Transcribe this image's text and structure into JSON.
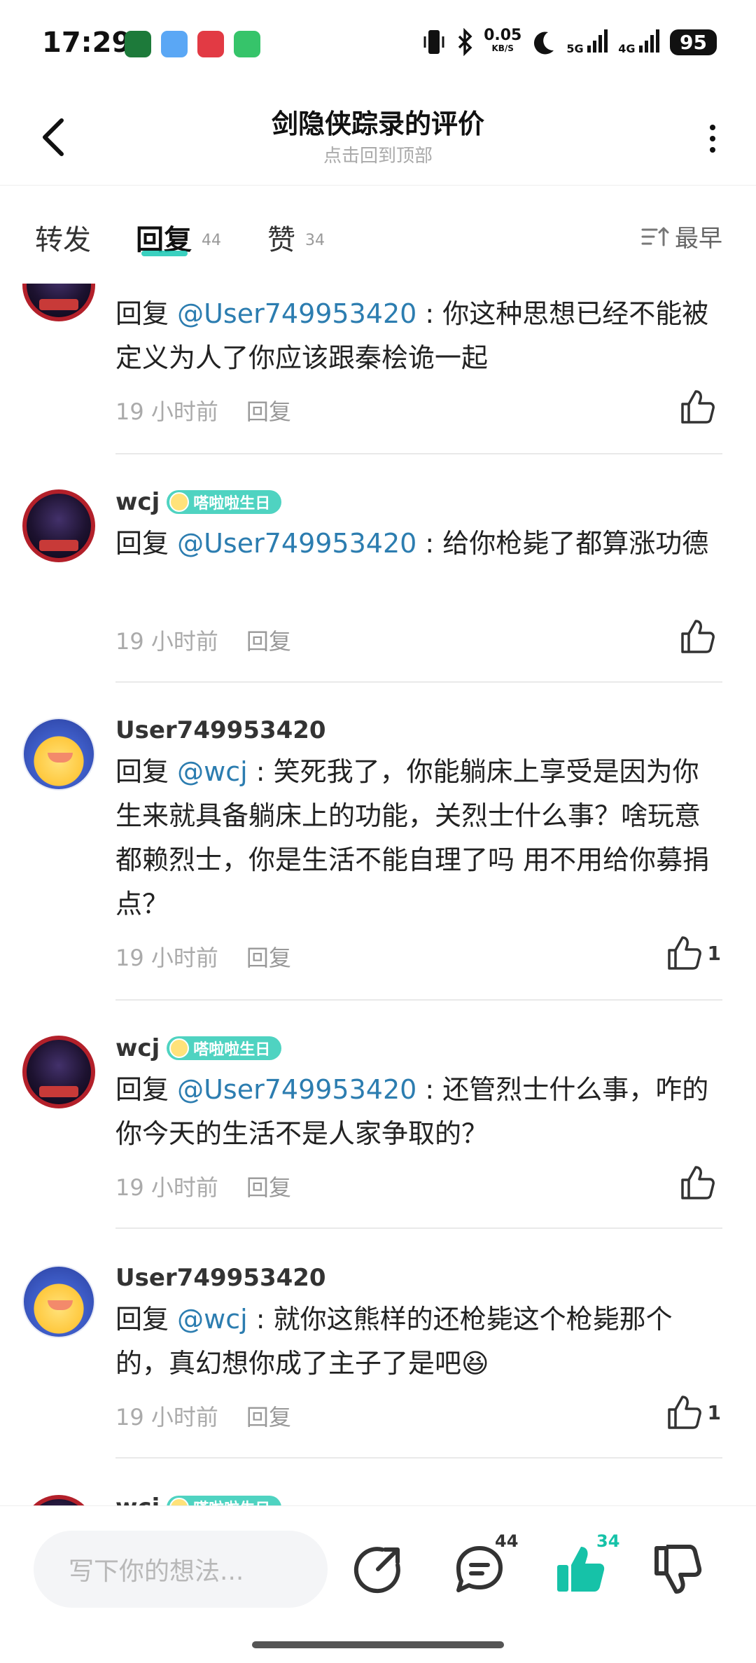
{
  "status": {
    "time": "17:29",
    "speed_value": "0.05",
    "speed_unit": "KB/S",
    "net1": "5G",
    "net2": "4G",
    "battery": "95"
  },
  "header": {
    "title": "剑隐侠踪录的评价",
    "subtitle": "点击回到顶部"
  },
  "tabs": [
    {
      "label": "转发",
      "count": ""
    },
    {
      "label": "回复",
      "count": "44"
    },
    {
      "label": "赞",
      "count": "34"
    }
  ],
  "sort_label": "最早",
  "comments": [
    {
      "user": "",
      "badge": "",
      "reply_prefix": "回复",
      "mention": "@User749953420",
      "body": "你这种思想已经不能被定义为人了你应该跟秦桧诡一起",
      "time": "19 小时前",
      "reply_label": "回复",
      "likes": ""
    },
    {
      "user": "wcj",
      "badge": "嗒啦啦生日",
      "reply_prefix": "回复",
      "mention": "@User749953420",
      "body": "给你枪毙了都算涨功德",
      "time": "19 小时前",
      "reply_label": "回复",
      "likes": ""
    },
    {
      "user": "User749953420",
      "badge": "",
      "reply_prefix": "回复",
      "mention": "@wcj",
      "body": "笑死我了，你能躺床上享受是因为你生来就具备躺床上的功能，关烈士什么事？啥玩意都赖烈士，你是生活不能自理了吗 用不用给你募捐点？",
      "time": "19 小时前",
      "reply_label": "回复",
      "likes": "1"
    },
    {
      "user": "wcj",
      "badge": "嗒啦啦生日",
      "reply_prefix": "回复",
      "mention": "@User749953420",
      "body": "还管烈士什么事，咋的你今天的生活不是人家争取的？",
      "time": "19 小时前",
      "reply_label": "回复",
      "likes": ""
    },
    {
      "user": "User749953420",
      "badge": "",
      "reply_prefix": "回复",
      "mention": "@wcj",
      "body": "就你这熊样的还枪毙这个枪毙那个的，真幻想你成了主子了是吧😆",
      "time": "19 小时前",
      "reply_label": "回复",
      "likes": "1"
    },
    {
      "user": "wcj",
      "badge": "嗒啦啦生日",
      "reply_prefix": "",
      "mention": "",
      "body": "",
      "time": "",
      "reply_label": "",
      "likes": ""
    }
  ],
  "bottom": {
    "input_placeholder": "写下你的想法...",
    "comment_count": "44",
    "like_count": "34"
  },
  "colors": {
    "accent": "#18c8b4",
    "mention": "#2c7db0",
    "like_active": "#16c2a8"
  }
}
